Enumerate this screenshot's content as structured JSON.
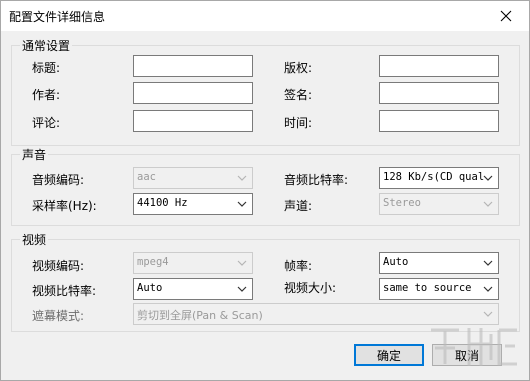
{
  "window": {
    "title": "配置文件详细信息"
  },
  "general": {
    "legend": "通常设置",
    "fields": [
      {
        "label": "标题:",
        "value": ""
      },
      {
        "label": "作者:",
        "value": ""
      },
      {
        "label": "评论:",
        "value": ""
      },
      {
        "label": "版权:",
        "value": ""
      },
      {
        "label": "签名:",
        "value": ""
      },
      {
        "label": "时间:",
        "value": ""
      }
    ]
  },
  "audio": {
    "legend": "声音",
    "codec_label": "音频编码:",
    "codec_value": "aac",
    "bitrate_label": "音频比特率:",
    "bitrate_value": "128 Kb/s(CD qual",
    "samplerate_label": "采样率(Hz):",
    "samplerate_value": "44100 Hz",
    "channels_label": "声道:",
    "channels_value": "Stereo"
  },
  "video": {
    "legend": "视频",
    "codec_label": "视频编码:",
    "codec_value": "mpeg4",
    "framerate_label": "帧率:",
    "framerate_value": "Auto",
    "bitrate_label": "视频比特率:",
    "bitrate_value": "Auto",
    "size_label": "视频大小:",
    "size_value": "same to source",
    "mask_label": "遮幕模式:",
    "mask_value": "剪切到全屏(Pan & Scan)"
  },
  "buttons": {
    "ok": "确定",
    "cancel": "取消"
  },
  "icons": {
    "close": "close-icon",
    "dropdown": "chevron-down-icon",
    "watermark": "site-watermark-logo"
  }
}
